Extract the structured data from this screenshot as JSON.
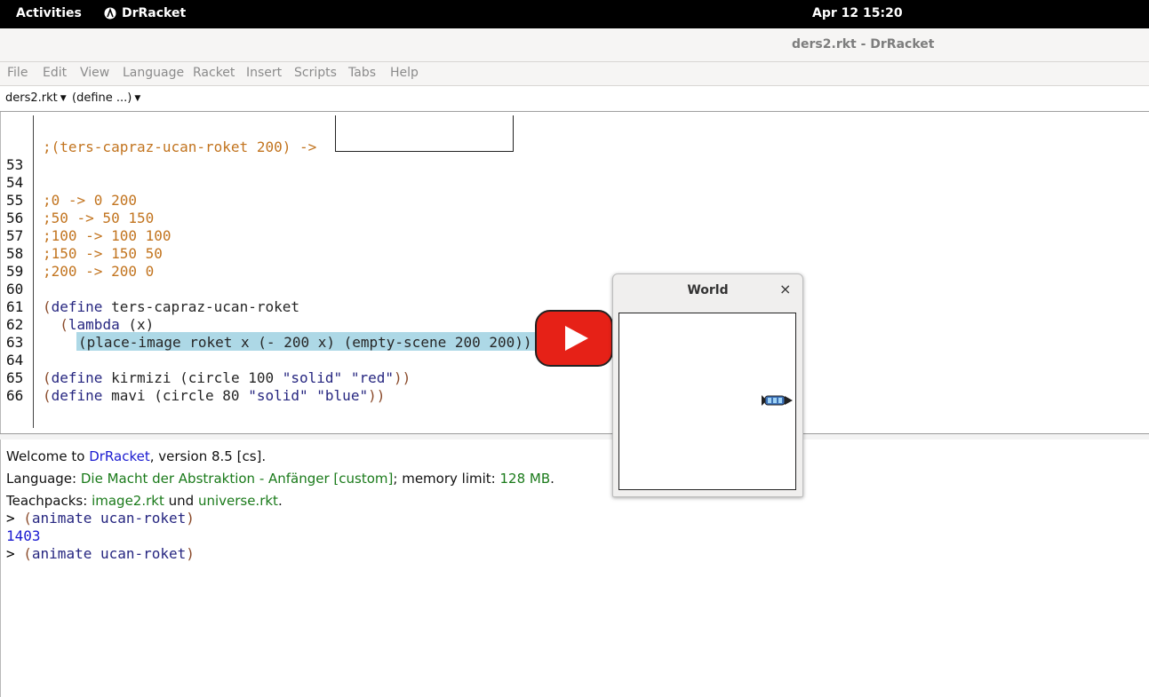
{
  "topbar": {
    "activities": "Activities",
    "app_name": "DrRacket",
    "clock": "Apr 12  15:20"
  },
  "window": {
    "title": "ders2.rkt - DrRacket"
  },
  "menu": [
    "File",
    "Edit",
    "View",
    "Language",
    "Racket",
    "Insert",
    "Scripts",
    "Tabs",
    "Help"
  ],
  "toolbar": {
    "file_dropdown": "ders2.rkt",
    "define_dropdown": "(define ...)"
  },
  "editor": {
    "line_numbers": [
      "53",
      "54",
      "55",
      "56",
      "57",
      "58",
      "59",
      "60",
      "61",
      "62",
      "63",
      "64",
      "65",
      "66"
    ],
    "line_0_comment": ";(ters-capraz-ucan-roket 200) ->",
    "line_55": ";0 -> 0 200",
    "line_56": ";50 -> 50 150",
    "line_57": ";100 -> 100 100",
    "line_58": ";150 -> 150 50",
    "line_59": ";200 -> 200 0",
    "line_61": {
      "open": "(",
      "kw": "define",
      "rest": " ters-capraz-ucan-roket"
    },
    "line_62": {
      "indent": "  ",
      "open": "(",
      "kw": "lambda",
      "rest": " (x)"
    },
    "line_63": "(place-image roket x (- 200 x) (empty-scene 200 200))",
    "line_65": {
      "open": "(",
      "kw": "define",
      "id": " kirmizi ",
      "call": "(circle 100 ",
      "s1": "\"solid\"",
      "sp": " ",
      "s2": "\"red\"",
      "close": "))"
    },
    "line_66": {
      "open": "(",
      "kw": "define",
      "id": " mavi ",
      "call": "(circle 80 ",
      "s1": "\"solid\"",
      "sp": " ",
      "s2": "\"blue\"",
      "close": "))"
    }
  },
  "repl": {
    "welcome_pre": "Welcome to ",
    "welcome_link": "DrRacket",
    "welcome_post": ", version 8.5 [cs].",
    "language_pre": "Language: ",
    "language_name": "Die Macht der Abstraktion - Anfänger [custom]",
    "language_mid": "; memory limit: ",
    "memory": "128 MB",
    "language_post": ".",
    "teachpacks_pre": "Teachpacks: ",
    "teachpack_1": "image2.rkt",
    "teachpacks_mid": " und ",
    "teachpack_2": "universe.rkt",
    "teachpacks_post": ".",
    "prompt": "> ",
    "cmd_1": "(animate ucan-roket)",
    "result_1": "1403",
    "cmd_2": "(animate ucan-roket)"
  },
  "world_window": {
    "title": "World",
    "close": "×"
  },
  "colors": {
    "comment": "#c2741f",
    "keyword": "#262680",
    "highlight": "#add8e6",
    "play_red": "#e62117"
  }
}
